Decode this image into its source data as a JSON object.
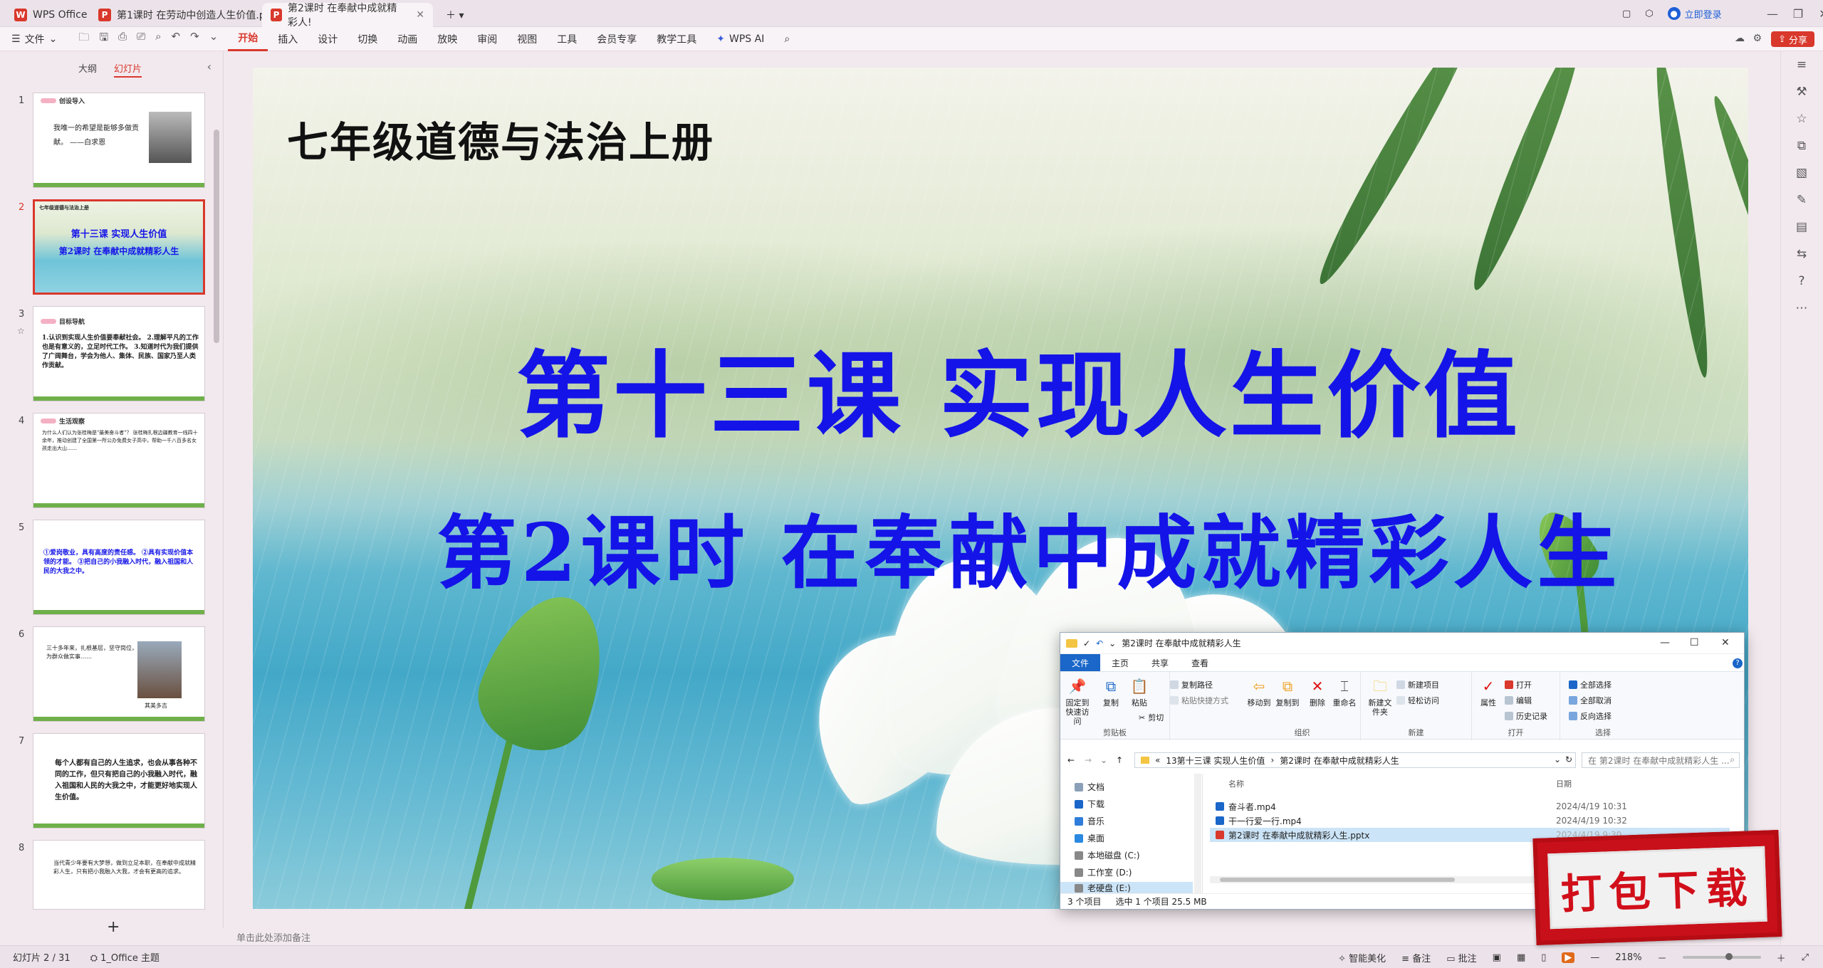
{
  "titlebar": {
    "tabs": [
      {
        "label": "WPS Office"
      },
      {
        "label": "第1课时 在劳动中创造人生价值.pp"
      },
      {
        "label": "第2课时 在奉献中成就精彩人!"
      }
    ],
    "login": "立即登录"
  },
  "ribbon": {
    "file_menu": "文件",
    "tabs": [
      "开始",
      "插入",
      "设计",
      "切换",
      "动画",
      "放映",
      "审阅",
      "视图",
      "工具",
      "会员专享",
      "教学工具"
    ],
    "wps_ai": "WPS AI",
    "share": "分享"
  },
  "thumbpanel": {
    "tab_outline": "大纲",
    "tab_slides": "幻灯片",
    "slides": [
      {
        "num": "1",
        "header": "创设导入",
        "text": "我唯一的希望是能够多做贡献。 ——白求恩"
      },
      {
        "num": "2",
        "top": "七年级道德与法治上册",
        "title": "第十三课  实现人生价值",
        "sub": "第2课时  在奉献中成就精彩人生"
      },
      {
        "num": "3",
        "header": "目标导航",
        "text": "1.认识到实现人生价值要奉献社会。 2.理解平凡的工作也是有意义的，立足时代工作。 3.知道时代为我们提供了广阔舞台，学会为他人、集体、民族、国家乃至人类作贡献。"
      },
      {
        "num": "4",
        "header": "生活观察",
        "text": "为什么人们认为张桂梅是\"最美奋斗者\"？ 张桂梅扎根边疆教育一线四十余年，推动创建了全国第一所公办免费女子高中，帮助一千八百多名女孩走出大山……"
      },
      {
        "num": "5",
        "text": "①爱岗敬业，具有高度的责任感。 ②具有实现价值本领的才能。 ③把自己的小我融入时代，融入祖国和人民的大我之中。"
      },
      {
        "num": "6",
        "text": "三十多年来，扎根基层，坚守岗位，为群众做实事……",
        "caption": "其美多吉"
      },
      {
        "num": "7",
        "text": "每个人都有自己的人生追求，也会从事各种不同的工作，但只有把自己的小我融入时代，融入祖国和人民的大我之中，才能更好地实现人生价值。"
      },
      {
        "num": "8",
        "text": "当代青少年要有大梦想，做到立足本职，在奉献中成就精彩人生，只有把小我融入大我，才会有更高的追求。"
      }
    ]
  },
  "slide": {
    "top_title": "七年级道德与法治上册",
    "title": "第十三课  实现人生价值",
    "subtitle": "第2课时  在奉献中成就精彩人生"
  },
  "notes_placeholder": "单击此处添加备注",
  "statusbar": {
    "slide_count": "幻灯片 2 / 31",
    "theme": "1_Office 主题",
    "smart": "智能美化",
    "notes": "备注",
    "comments": "批注",
    "zoom": "218%"
  },
  "explorer": {
    "title": "第2课时 在奉献中成就精彩人生",
    "tabs": [
      "文件",
      "主页",
      "共享",
      "查看"
    ],
    "ribbon": {
      "pin": "固定到快速访问",
      "copy": "复制",
      "paste": "粘贴",
      "copy_path": "复制路径",
      "paste_shortcut": "粘贴快捷方式",
      "cut": "剪切",
      "clipboard": "剪贴板",
      "move_to": "移动到",
      "copy_to": "复制到",
      "delete": "删除",
      "rename": "重命名",
      "organize": "组织",
      "new_folder": "新建文件夹",
      "new_item": "新建项目",
      "easy_access": "轻松访问",
      "new": "新建",
      "properties": "属性",
      "open": "打开",
      "edit": "编辑",
      "history": "历史记录",
      "open_group": "打开",
      "select_all": "全部选择",
      "select_none": "全部取消",
      "invert": "反向选择",
      "select_group": "选择"
    },
    "path": [
      "13第十三课 实现人生价值",
      "第2课时 在奉献中成就精彩人生"
    ],
    "search_placeholder": "在 第2课时 在奉献中成就精彩人生 ...",
    "nav": [
      {
        "label": "文档"
      },
      {
        "label": "下载"
      },
      {
        "label": "音乐"
      },
      {
        "label": "桌面"
      },
      {
        "label": "本地磁盘 (C:)"
      },
      {
        "label": "工作室 (D:)"
      },
      {
        "label": "老硬盘 (E:)"
      }
    ],
    "columns": {
      "name": "名称",
      "date": "日期"
    },
    "files": [
      {
        "name": "奋斗者.mp4",
        "date": "2024/4/19 10:31"
      },
      {
        "name": "干一行爱一行.mp4",
        "date": "2024/4/19 10:32"
      },
      {
        "name": "第2课时 在奉献中成就精彩人生.pptx",
        "date": "2024/4/19 9:30"
      }
    ],
    "status": {
      "items": "3 个项目",
      "selected": "选中 1 个项目  25.5 MB"
    }
  },
  "stamp": "打包下载",
  "colors": {
    "accent": "#d9382c",
    "slide_text": "#1414e8"
  }
}
